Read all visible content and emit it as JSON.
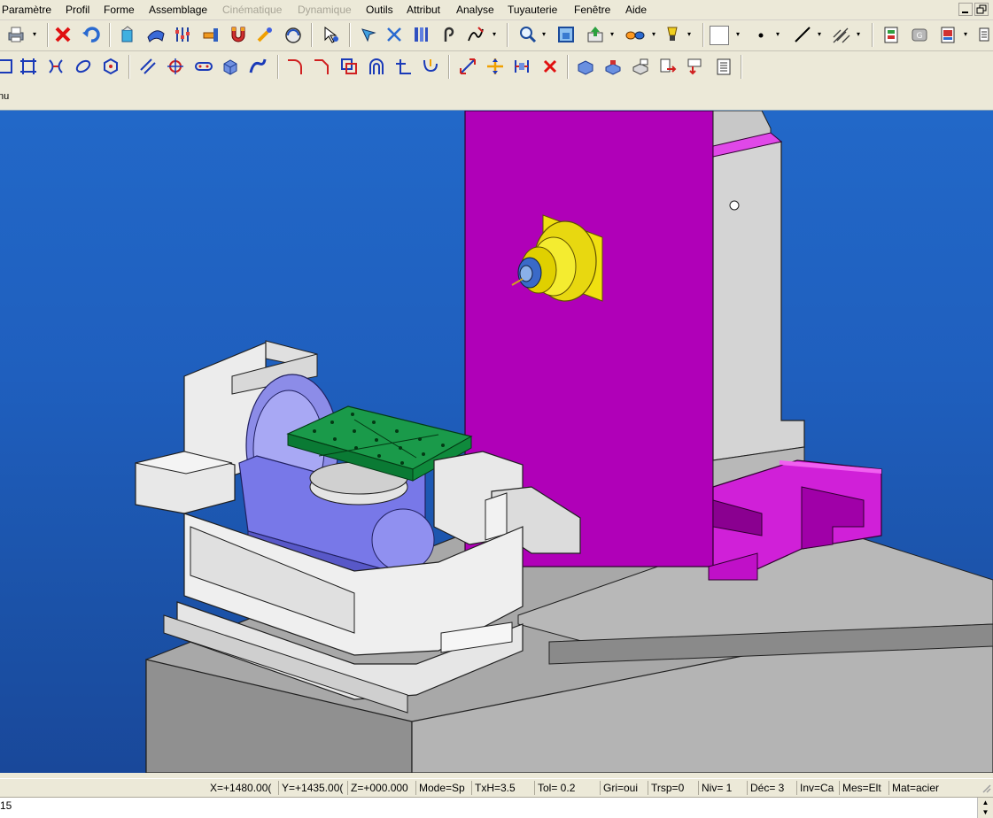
{
  "menubar": {
    "items": [
      {
        "label": "Paramètre",
        "enabled": true
      },
      {
        "label": "Profil",
        "enabled": true
      },
      {
        "label": "Forme",
        "enabled": true
      },
      {
        "label": "Assemblage",
        "enabled": true
      },
      {
        "label": "Cinématique",
        "enabled": false
      },
      {
        "label": "Dynamique",
        "enabled": false
      },
      {
        "label": "Outils",
        "enabled": true
      },
      {
        "label": "Attribut",
        "enabled": true
      },
      {
        "label": "Analyse",
        "enabled": true
      },
      {
        "label": "Tuyauterie",
        "enabled": true
      },
      {
        "label": "Fenêtre",
        "enabled": true
      },
      {
        "label": "Aide",
        "enabled": true
      }
    ]
  },
  "toolbar1": {
    "icons": [
      "print-icon",
      "delete-icon",
      "undo-icon",
      "fill-icon",
      "stretch-icon",
      "sliders-icon",
      "hammer-icon",
      "magnet-icon",
      "wand-icon",
      "measure-icon",
      "select-arrow-icon",
      "select-point-icon",
      "cross-icon",
      "columns-icon",
      "hook-icon",
      "edit-icon",
      "zoom-icon",
      "fit-icon",
      "export-icon",
      "glasses-icon",
      "lamp-icon",
      "color-swatch",
      "dot-style-icon",
      "line-style-icon",
      "hatch-icon",
      "layers-icon",
      "group-icon",
      "doc-icon"
    ]
  },
  "toolbar2": {
    "icons": [
      "rect-icon",
      "frame-icon",
      "trim-icon",
      "ellipse-icon",
      "polygon-icon",
      "parallel-icon",
      "target-icon",
      "slot-icon",
      "solid-icon",
      "sweep-icon",
      "fillet-icon",
      "chamfer-icon",
      "union-icon",
      "arch-icon",
      "axes-icon",
      "spring-icon",
      "dimension-icon",
      "move-icon",
      "align-icon",
      "close-red-icon",
      "layer-a-icon",
      "layer-b-icon",
      "layer-c-icon",
      "layer-d-icon",
      "layer-e-icon",
      "list-icon"
    ]
  },
  "tab": {
    "label": "nu"
  },
  "statusbar": {
    "cells": [
      {
        "label": "X=+1480.00("
      },
      {
        "label": "Y=+1435.00("
      },
      {
        "label": "Z=+000.000"
      },
      {
        "label": "Mode=Sp"
      },
      {
        "label": "TxH=3.5"
      },
      {
        "label": "Tol=   0.2"
      },
      {
        "label": "Gri=oui"
      },
      {
        "label": "Trsp=0"
      },
      {
        "label": "Niv=  1"
      },
      {
        "label": "Déc= 3"
      },
      {
        "label": "Inv=Ca"
      },
      {
        "label": "Mes=Elt"
      },
      {
        "label": "Mat=acier"
      }
    ]
  },
  "commandline": {
    "text": "15"
  },
  "colors": {
    "viewport_bg": "#2064c4",
    "column": "#b000b8",
    "spindle": "#f0e010",
    "table": "#0a8a3a",
    "trunnion": "#7878e8",
    "base": "#c8c8c8"
  }
}
